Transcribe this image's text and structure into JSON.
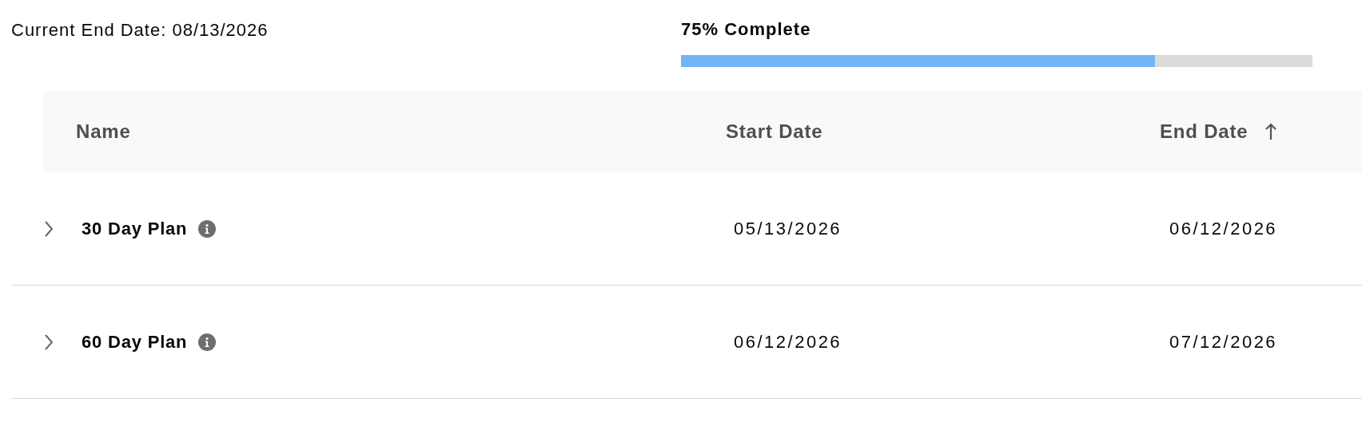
{
  "current_end_date": "Current End Date: 08/13/2026",
  "progress": {
    "label": "75% Complete",
    "level": 0.75
  },
  "table": {
    "columns": [
      {
        "label": "Name",
        "sorted": false
      },
      {
        "label": "Start Date",
        "sorted": false
      },
      {
        "label": "End Date",
        "sorted": true
      }
    ],
    "rows": [
      {
        "name": "30 Day Plan",
        "start_date": "05/13/2026",
        "end_date": "06/12/2026",
        "expanded": false
      },
      {
        "name": "60 Day Plan",
        "start_date": "06/12/2026",
        "end_date": "07/12/2026",
        "expanded": false
      }
    ]
  }
}
